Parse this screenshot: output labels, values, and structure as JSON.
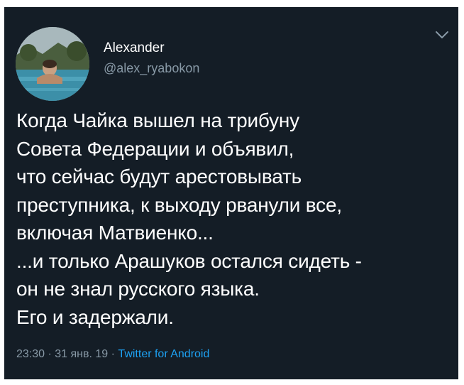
{
  "tweet": {
    "user": {
      "display_name": "Alexander",
      "handle": "@alex_ryabokon",
      "avatar_icon": "profile-photo-pool"
    },
    "menu_icon": "chevron-down-icon",
    "text_lines": [
      "Когда Чайка вышел на трибуну",
      "Совета Федерации и объявил,",
      "что сейчас будут арестовывать",
      "преступника, к выходу рванули все,",
      "включая Матвиенко...",
      "...и только Арашуков остался сидеть -",
      "он не знал русского языка.",
      "Его и задержали."
    ],
    "meta": {
      "time": "23:30",
      "separator": " · ",
      "date": "31 янв. 19",
      "source": "Twitter for Android"
    }
  },
  "colors": {
    "background": "#141d26",
    "text": "#ffffff",
    "muted": "#8899a6",
    "link": "#1da1f2"
  }
}
